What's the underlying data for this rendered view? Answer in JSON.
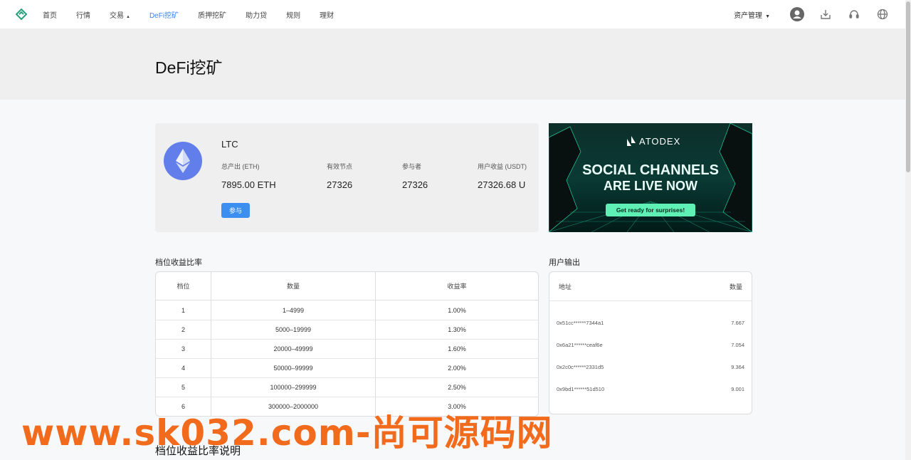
{
  "nav": {
    "items": [
      "首页",
      "行情",
      "交易",
      "DeFi挖矿",
      "质押挖矿",
      "助力贷",
      "规则",
      "理财"
    ],
    "active": 3,
    "asset_menu": "资产管理",
    "icons": [
      "user-icon",
      "download-icon",
      "headset-icon",
      "globe-icon"
    ]
  },
  "hero": {
    "title": "DeFi挖矿"
  },
  "card": {
    "coin": "LTC",
    "stats": [
      {
        "label": "总产出 (ETH)",
        "value": "7895.00 ETH"
      },
      {
        "label": "有效节点",
        "value": "27326"
      },
      {
        "label": "参与者",
        "value": "27326"
      },
      {
        "label": "用户收益 (USDT)",
        "value": "27326.68 U"
      }
    ],
    "join_label": "参与"
  },
  "banner": {
    "brand": "ATODEX",
    "line1": "SOCIAL CHANNELS",
    "line2": "ARE LIVE NOW",
    "cta": "Get ready for surprises!"
  },
  "rates": {
    "title": "档位收益比率",
    "headers": [
      "档位",
      "数量",
      "收益率"
    ],
    "rows": [
      [
        "1",
        "1–4999",
        "1.00%"
      ],
      [
        "2",
        "5000–19999",
        "1.30%"
      ],
      [
        "3",
        "20000–49999",
        "1.60%"
      ],
      [
        "4",
        "50000–99999",
        "2.00%"
      ],
      [
        "5",
        "100000–299999",
        "2.50%"
      ],
      [
        "6",
        "300000–2000000",
        "3.00%"
      ]
    ]
  },
  "output": {
    "title": "用户输出",
    "headers": [
      "地址",
      "数量"
    ],
    "rows": [
      [
        "0x51cc******7344a1",
        "7.667"
      ],
      [
        "0x6a21******ceaf6e",
        "7.054"
      ],
      [
        "0x2c0c******2331d5",
        "9.364"
      ],
      [
        "0x9bd1******51d510",
        "9.001"
      ]
    ]
  },
  "explain": {
    "title": "档位收益比率说明"
  },
  "watermark": "www.sk032.com-尚可源码网",
  "colors": {
    "accent": "#3b8ff0",
    "eth": "#627eea",
    "watermark": "#f26b1d"
  }
}
